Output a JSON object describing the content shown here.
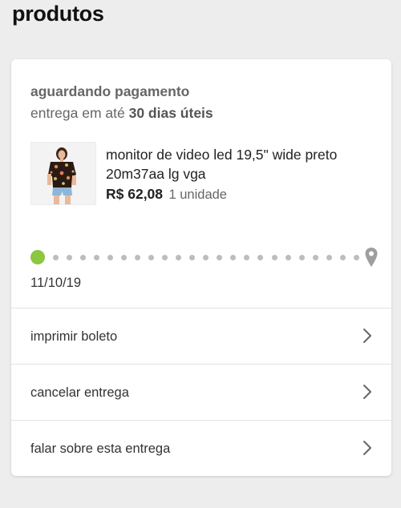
{
  "page": {
    "title": "produtos"
  },
  "order": {
    "status": "aguardando pagamento",
    "delivery_prefix": "entrega em até",
    "delivery_days": "30 dias úteis",
    "product": {
      "name": "monitor de video led 19,5\" wide preto 20m37aa lg vga",
      "price": "R$ 62,08",
      "quantity": "1 unidade",
      "image_icon": "product-photo-blouse"
    },
    "tracker": {
      "date": "11/10/19",
      "start_color": "#8dc63f",
      "dot_color": "#bdbdbd",
      "end_icon": "location-pin-icon",
      "progress": 0
    },
    "actions": [
      {
        "label": "imprimir boleto",
        "icon": "chevron-right-icon"
      },
      {
        "label": "cancelar entrega",
        "icon": "chevron-right-icon"
      },
      {
        "label": "falar sobre esta entrega",
        "icon": "chevron-right-icon"
      }
    ]
  },
  "colors": {
    "background": "#ededed",
    "card": "#ffffff",
    "accent_green": "#8dc63f",
    "text_primary": "#222222",
    "text_secondary": "#666666"
  }
}
